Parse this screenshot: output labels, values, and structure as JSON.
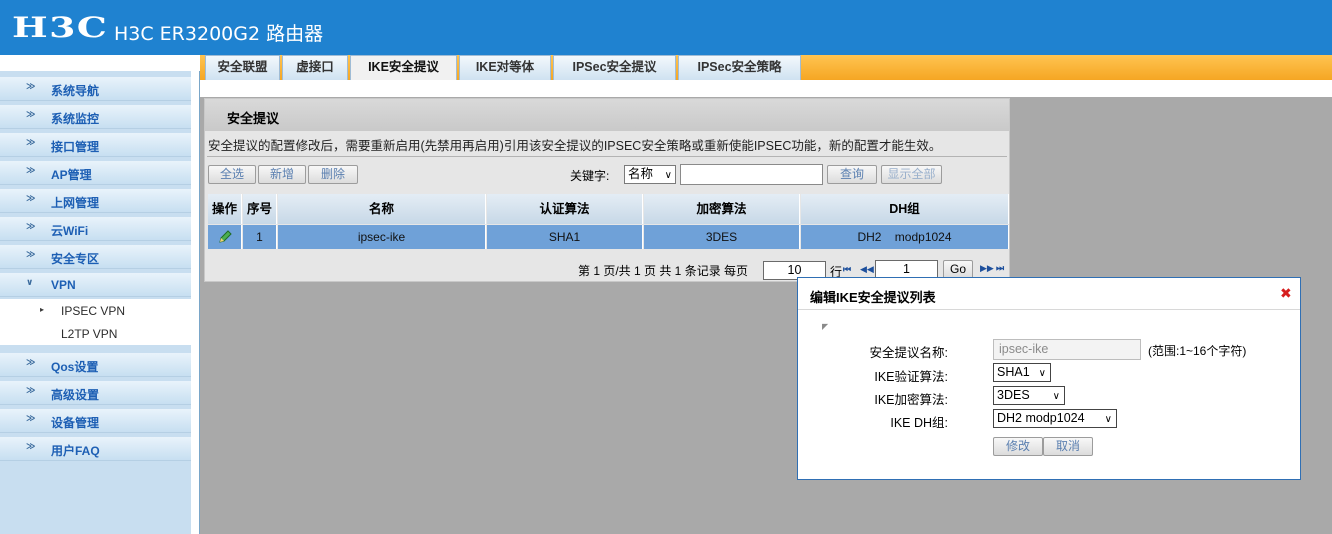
{
  "header": {
    "logo": "H3C",
    "title": "H3C ER3200G2 路由器"
  },
  "sidebar": {
    "items": [
      {
        "label": "系统导航"
      },
      {
        "label": "系统监控"
      },
      {
        "label": "接口管理"
      },
      {
        "label": "AP管理"
      },
      {
        "label": "上网管理"
      },
      {
        "label": "云WiFi"
      },
      {
        "label": "安全专区"
      },
      {
        "label": "VPN"
      },
      {
        "label": "Qos设置"
      },
      {
        "label": "高级设置"
      },
      {
        "label": "设备管理"
      },
      {
        "label": "用户FAQ"
      }
    ],
    "vpn_sub": [
      {
        "label": "IPSEC VPN"
      },
      {
        "label": "L2TP VPN"
      }
    ]
  },
  "tabs": [
    {
      "label": "安全联盟"
    },
    {
      "label": "虚接口"
    },
    {
      "label": "IKE安全提议"
    },
    {
      "label": "IKE对等体"
    },
    {
      "label": "IPSec安全提议"
    },
    {
      "label": "IPSec安全策略"
    }
  ],
  "panel": {
    "title": "安全提议",
    "notice": "安全提议的配置修改后，需要重新启用(先禁用再启用)引用该安全提议的IPSEC安全策略或重新使能IPSEC功能，新的配置才能生效。",
    "buttons": {
      "select_all": "全选",
      "add": "新增",
      "delete": "删除",
      "query": "查询",
      "show_all": "显示全部"
    },
    "keyword_label": "关键字:",
    "keyword_field": "名称",
    "keyword_value": "",
    "table": {
      "headers": [
        "操作",
        "序号",
        "名称",
        "认证算法",
        "加密算法",
        "DH组"
      ],
      "rows": [
        {
          "index": "1",
          "name": "ipsec-ike",
          "auth": "SHA1",
          "enc": "3DES",
          "dh": "DH2    modp1024"
        }
      ]
    },
    "pager": {
      "text": "第 1 页/共 1 页 共 1 条记录 每页",
      "per_page": "10",
      "row_label": "行",
      "page": "1",
      "go": "Go"
    }
  },
  "dialog": {
    "title": "编辑IKE安全提议列表",
    "close_icon": "✖",
    "fields": {
      "name_label": "安全提议名称:",
      "name_value": "ipsec-ike",
      "name_hint": "(范围:1~16个字符)",
      "auth_label": "IKE验证算法:",
      "auth_value": "SHA1",
      "enc_label": "IKE加密算法:",
      "enc_value": "3DES",
      "dh_label": "IKE DH组:",
      "dh_value": "DH2 modp1024"
    },
    "buttons": {
      "modify": "修改",
      "cancel": "取消"
    }
  },
  "colors": {
    "header_bg": "#1f82d0",
    "tab_bar": "#f5a623",
    "row_selected": "#6fa1d8",
    "link_blue": "#1d5fb4",
    "close_red": "#d61e1e"
  }
}
